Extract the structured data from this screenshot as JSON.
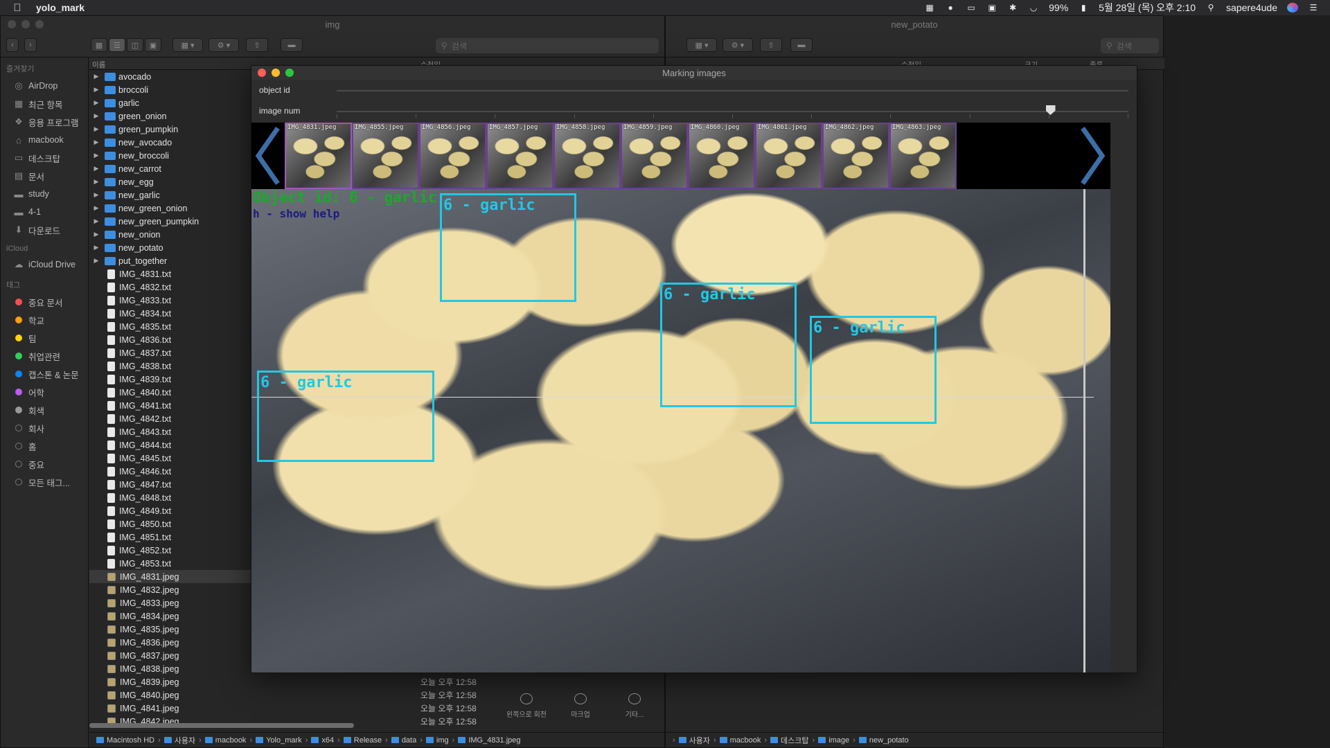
{
  "menubar": {
    "app_name": "yolo_mark",
    "battery": "99%",
    "datetime": "5월 28일 (목) 오후 2:10",
    "user": "sapere4ude"
  },
  "finder_left": {
    "title": "img",
    "search_placeholder": "검색",
    "columns": {
      "name": "이름",
      "modified": "수정일"
    },
    "sidebar": {
      "favorites_label": "즐겨찾기",
      "favorites": [
        "AirDrop",
        "최근 항목",
        "응용 프로그램",
        "macbook",
        "데스크탑",
        "문서",
        "study",
        "4-1",
        "다운로드"
      ],
      "icloud_label": "iCloud",
      "icloud": [
        "iCloud Drive"
      ],
      "tags_label": "태그",
      "tags": [
        {
          "label": "중요 문서",
          "color": "#ff4d4d"
        },
        {
          "label": "학교",
          "color": "#ff9f0a"
        },
        {
          "label": "팀",
          "color": "#ffd60a"
        },
        {
          "label": "취업관련",
          "color": "#30d158"
        },
        {
          "label": "캡스톤 & 논문",
          "color": "#0a84ff"
        },
        {
          "label": "어학",
          "color": "#bf5af2"
        },
        {
          "label": "회색",
          "color": "#98989d"
        },
        {
          "label": "회사",
          "color": ""
        },
        {
          "label": "홈",
          "color": ""
        },
        {
          "label": "중요",
          "color": ""
        },
        {
          "label": "모든 태그...",
          "color": ""
        }
      ]
    },
    "folders": [
      "avocado",
      "broccoli",
      "garlic",
      "green_onion",
      "green_pumpkin",
      "new_avocado",
      "new_broccoli",
      "new_carrot",
      "new_egg",
      "new_garlic",
      "new_green_onion",
      "new_green_pumpkin",
      "new_onion",
      "new_potato",
      "put_together"
    ],
    "txt_files": [
      "IMG_4831.txt",
      "IMG_4832.txt",
      "IMG_4833.txt",
      "IMG_4834.txt",
      "IMG_4835.txt",
      "IMG_4836.txt",
      "IMG_4837.txt",
      "IMG_4838.txt",
      "IMG_4839.txt",
      "IMG_4840.txt",
      "IMG_4841.txt",
      "IMG_4842.txt",
      "IMG_4843.txt",
      "IMG_4844.txt",
      "IMG_4845.txt",
      "IMG_4846.txt",
      "IMG_4847.txt",
      "IMG_4848.txt",
      "IMG_4849.txt",
      "IMG_4850.txt",
      "IMG_4851.txt",
      "IMG_4852.txt",
      "IMG_4853.txt"
    ],
    "jpeg_files": [
      {
        "name": "IMG_4831.jpeg",
        "date": ""
      },
      {
        "name": "IMG_4832.jpeg",
        "date": ""
      },
      {
        "name": "IMG_4833.jpeg",
        "date": ""
      },
      {
        "name": "IMG_4834.jpeg",
        "date": ""
      },
      {
        "name": "IMG_4835.jpeg",
        "date": ""
      },
      {
        "name": "IMG_4836.jpeg",
        "date": ""
      },
      {
        "name": "IMG_4837.jpeg",
        "date": ""
      },
      {
        "name": "IMG_4838.jpeg",
        "date": ""
      },
      {
        "name": "IMG_4839.jpeg",
        "date": "오늘 오후 12:58"
      },
      {
        "name": "IMG_4840.jpeg",
        "date": "오늘 오후 12:58"
      },
      {
        "name": "IMG_4841.jpeg",
        "date": "오늘 오후 12:58"
      },
      {
        "name": "IMG_4842.jpeg",
        "date": "오늘 오후 12:58"
      }
    ],
    "path": [
      "Macintosh HD",
      "사용자",
      "macbook",
      "Yolo_mark",
      "x64",
      "Release",
      "data",
      "img",
      "IMG_4831.jpeg"
    ]
  },
  "finder_right": {
    "title": "new_potato",
    "search_placeholder": "검색",
    "columns": {
      "modified": "수정일",
      "size": "크기",
      "kind": "종류"
    },
    "tools": [
      "왼쪽으로 회전",
      "마크업",
      "기타..."
    ],
    "path": [
      "사용자",
      "macbook",
      "데스크탑",
      "image",
      "new_potato"
    ]
  },
  "marker": {
    "title": "Marking images",
    "object_id_label": "object id",
    "image_num_label": "image num",
    "image_num_position": 0.9,
    "thumbnails": [
      "IMG_4831.jpeg",
      "IMG_4855.jpeg",
      "IMG_4856.jpeg",
      "IMG_4857.jpeg",
      "IMG_4858.jpeg",
      "IMG_4859.jpeg",
      "IMG_4860.jpeg",
      "IMG_4861.jpeg",
      "IMG_4862.jpeg",
      "IMG_4863.jpeg"
    ],
    "overlay_title": "Object id: 6   - garlic",
    "overlay_help": "h - show help",
    "boxes": [
      "6 - garlic",
      "6 - garlic",
      "6 - garlic",
      "6 - garlic"
    ],
    "box_color": "#20c8e6"
  }
}
